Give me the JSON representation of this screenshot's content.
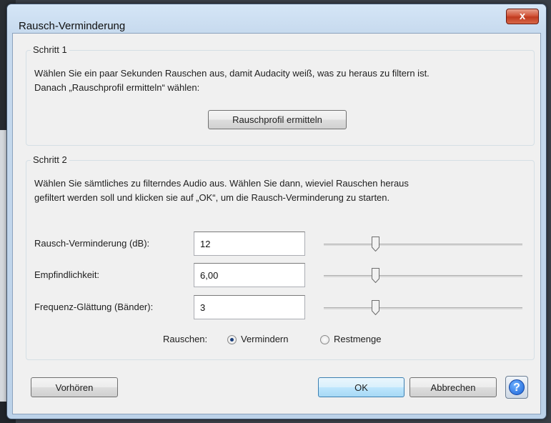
{
  "window": {
    "title": "Rausch-Verminderung",
    "close_glyph": "x"
  },
  "step1": {
    "legend": "Schritt 1",
    "line1": "Wählen Sie ein paar Sekunden Rauschen aus, damit Audacity weiß, was zu heraus zu filtern ist.",
    "line2": "Danach „Rauschprofil ermitteln“ wählen:",
    "profile_button": "Rauschprofil ermitteln"
  },
  "step2": {
    "legend": "Schritt 2",
    "line1": "Wählen Sie sämtliches zu filterndes Audio aus. Wählen Sie dann, wieviel Rauschen heraus",
    "line2": "gefiltert werden soll und klicken sie auf „OK“, um die Rausch-Verminderung zu starten.",
    "params": [
      {
        "label": "Rausch-Verminderung (dB):",
        "value": "12",
        "slider_fraction": 0.25
      },
      {
        "label": "Empfindlichkeit:",
        "value": "6,00",
        "slider_fraction": 0.25
      },
      {
        "label": "Frequenz-Glättung (Bänder):",
        "value": "3",
        "slider_fraction": 0.25
      }
    ],
    "noise_label": "Rauschen:",
    "options": [
      {
        "label": "Vermindern",
        "selected": true
      },
      {
        "label": "Restmenge",
        "selected": false
      }
    ]
  },
  "buttons": {
    "preview": "Vorhören",
    "ok": "OK",
    "cancel": "Abbrechen",
    "help": "?"
  }
}
